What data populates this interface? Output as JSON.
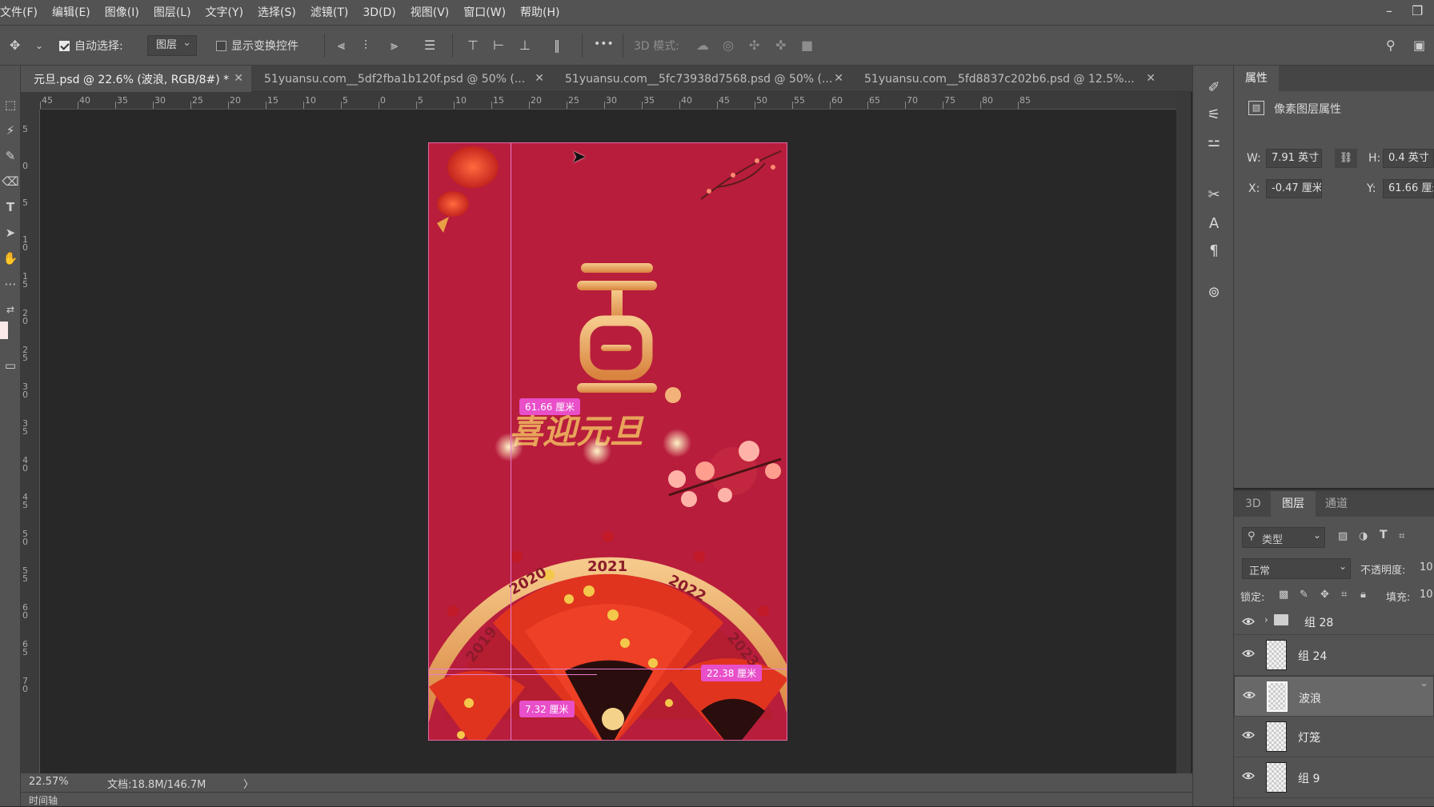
{
  "menu": [
    "文件(F)",
    "编辑(E)",
    "图像(I)",
    "图层(L)",
    "文字(Y)",
    "选择(S)",
    "滤镜(T)",
    "3D(D)",
    "视图(V)",
    "窗口(W)",
    "帮助(H)"
  ],
  "options": {
    "auto_select_label": "自动选择:",
    "auto_select_target": "图层",
    "show_transform_label": "显示变换控件",
    "mode_3d_label": "3D 模式:",
    "more": "•••"
  },
  "tabs": [
    {
      "label": "元旦.psd @ 22.6% (波浪, RGB/8#) *",
      "active": true
    },
    {
      "label": "51yuansu.com__5df2fba1b120f.psd @ 50% (...",
      "active": false
    },
    {
      "label": "51yuansu.com__5fc73938d7568.psd @ 50% (...",
      "active": false
    },
    {
      "label": "51yuansu.com__5fd8837c202b6.psd @ 12.5%...",
      "active": false
    }
  ],
  "ruler_h": [
    "45",
    "40",
    "35",
    "30",
    "25",
    "20",
    "15",
    "10",
    "5",
    "0",
    "5",
    "10",
    "15",
    "20",
    "25",
    "30",
    "35",
    "40",
    "45",
    "50",
    "55",
    "60",
    "65",
    "70",
    "75",
    "80",
    "85"
  ],
  "ruler_v": [
    "5",
    "0",
    "5",
    "1 0",
    "1 5",
    "2 0",
    "2 5",
    "3 0",
    "3 5",
    "4 0",
    "4 5",
    "5 0",
    "5 5",
    "6 0",
    "6 5",
    "7 0"
  ],
  "measurements": {
    "top": "61.66 厘米",
    "right": "22.38 厘米",
    "bottom": "7.32 厘米"
  },
  "artwork": {
    "title_chars": "喜迎元旦",
    "years": [
      "2019",
      "2020",
      "2021",
      "2022",
      "2023"
    ],
    "colors": {
      "background": "#b81d3c",
      "gold": "#e8a45a"
    }
  },
  "status": {
    "zoom": "22.57%",
    "doc": "文档:18.8M/146.7M",
    "arrow": "〉",
    "timeline_label": "时间轴"
  },
  "properties": {
    "tab": "属性",
    "type_label": "像素图层属性",
    "w_label": "W:",
    "w_value": "7.91 英寸",
    "h_label": "H:",
    "h_value": "0.4 英寸",
    "x_label": "X:",
    "x_value": "-0.47 厘米",
    "y_label": "Y:",
    "y_value": "61.66 厘米"
  },
  "layers_panel": {
    "tabs": [
      "3D",
      "图层",
      "通道"
    ],
    "filter": "类型",
    "blend_mode": "正常",
    "opacity_label": "不透明度:",
    "opacity_value": "10",
    "lock_label": "锁定:",
    "fill_label": "填充:",
    "fill_value": "10",
    "layers": [
      {
        "name": "组 28",
        "kind": "group",
        "selected": false
      },
      {
        "name": "组 24",
        "kind": "smart",
        "selected": false
      },
      {
        "name": "波浪",
        "kind": "pixel",
        "selected": true
      },
      {
        "name": "灯笼",
        "kind": "pixel",
        "selected": false
      },
      {
        "name": "组 9",
        "kind": "smart",
        "selected": false
      }
    ]
  }
}
